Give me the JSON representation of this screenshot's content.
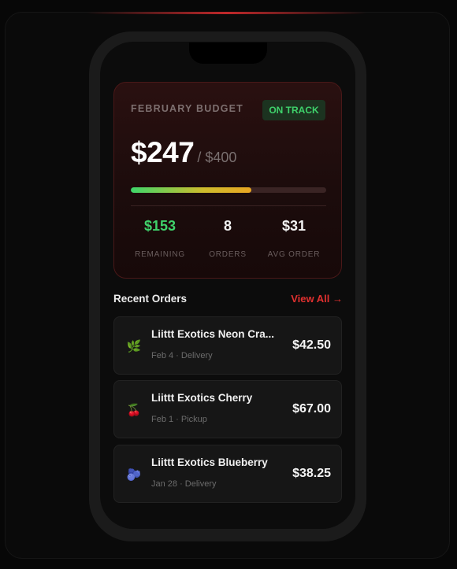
{
  "budget": {
    "title": "FEBRUARY BUDGET",
    "status": "ON TRACK",
    "spent": "$247",
    "limit": "/ $400",
    "progress_fraction": 0.6175,
    "stats": [
      {
        "value": "$153",
        "label": "REMAINING"
      },
      {
        "value": "8",
        "label": "ORDERS"
      },
      {
        "value": "$31",
        "label": "AVG ORDER"
      }
    ]
  },
  "recent": {
    "title": "Recent Orders",
    "view_all": "View All →"
  },
  "orders": [
    {
      "name": "Liittt Exotics Neon Cra...",
      "meta": "Feb 4 · Delivery",
      "price": "$42.50",
      "icon": "leaf-icon"
    },
    {
      "name": "Liittt Exotics Cherry",
      "meta": "Feb 1 · Pickup",
      "price": "$67.00",
      "icon": "cherry-icon"
    },
    {
      "name": "Liittt Exotics Blueberry",
      "meta": "Jan 28 · Delivery",
      "price": "$38.25",
      "icon": "blueberry-icon"
    }
  ],
  "colors": {
    "accent": "#e0302f",
    "positive": "#3fd26b",
    "background": "#0c0c0c"
  }
}
